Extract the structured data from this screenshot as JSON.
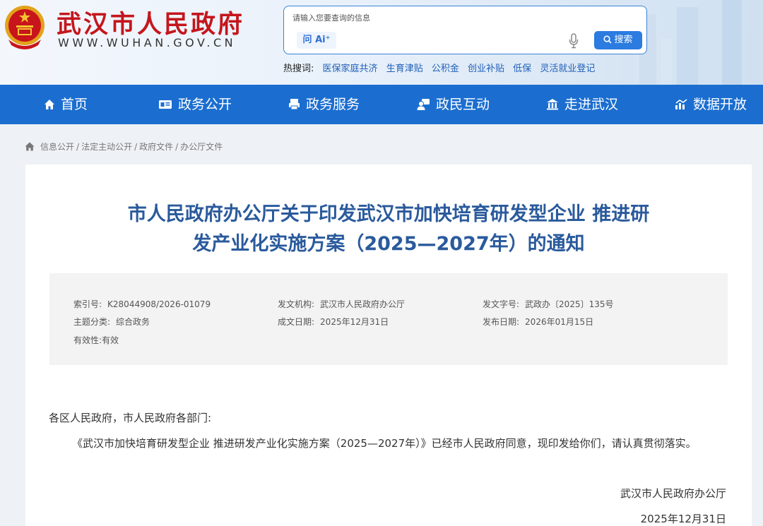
{
  "header": {
    "site_title": "武汉市人民政府",
    "site_url": "WWW.WUHAN.GOV.CN",
    "search": {
      "placeholder": "请输入您要查询的信息",
      "ai_label": "问 Ai⁺",
      "button_label": "搜索"
    },
    "hot": {
      "label": "热搜词:",
      "items": [
        "医保家庭共济",
        "生育津贴",
        "公积金",
        "创业补贴",
        "低保",
        "灵活就业登记"
      ]
    }
  },
  "nav": {
    "items": [
      {
        "label": "首页",
        "icon": "home-icon"
      },
      {
        "label": "政务公开",
        "icon": "id-card-icon"
      },
      {
        "label": "政务服务",
        "icon": "printer-icon"
      },
      {
        "label": "政民互动",
        "icon": "user-chat-icon"
      },
      {
        "label": "走进武汉",
        "icon": "building-icon"
      },
      {
        "label": "数据开放",
        "icon": "chart-icon"
      }
    ]
  },
  "breadcrumb": [
    "信息公开",
    "法定主动公开",
    "政府文件",
    "办公厅文件"
  ],
  "article": {
    "title_line1": "市人民政府办公厅关于印发武汉市加快培育研发型企业 推进研",
    "title_line2": "发产业化实施方案（2025—2027年）的通知",
    "meta": {
      "index_label": "索引号:",
      "index_value": "K28044908/2026-01079",
      "issuer_label": "发文机构:",
      "issuer_value": "武汉市人民政府办公厅",
      "docno_label": "发文字号:",
      "docno_value": "武政办〔2025〕135号",
      "category_label": "主题分类:",
      "category_value": "综合政务",
      "created_label": "成文日期:",
      "created_value": "2025年12月31日",
      "published_label": "发布日期:",
      "published_value": "2026年01月15日",
      "validity_label": "有效性:",
      "validity_value": "有效"
    },
    "salutation": "各区人民政府，市人民政府各部门:",
    "body": "《武汉市加快培育研发型企业   推进研发产业化实施方案（2025—2027年）》已经市人民政府同意，现印发给你们，请认真贯彻落实。",
    "signature_org": "武汉市人民政府办公厅",
    "signature_date": "2025年12月31日"
  },
  "colors": {
    "brand_red": "#c4161c",
    "nav_blue": "#1b6ed0",
    "title_blue": "#2a5a9c"
  }
}
